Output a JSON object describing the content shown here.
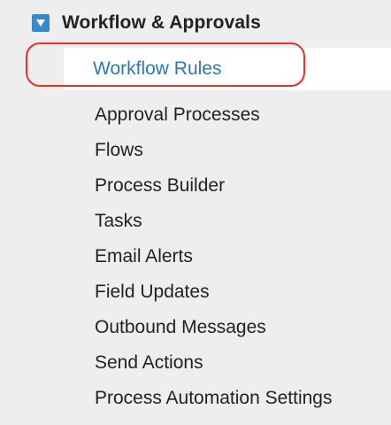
{
  "section": {
    "title": "Workflow & Approvals",
    "toggle_icon": "collapse-triangle-icon",
    "active_item": "Workflow Rules",
    "items": [
      "Approval Processes",
      "Flows",
      "Process Builder",
      "Tasks",
      "Email Alerts",
      "Field Updates",
      "Outbound Messages",
      "Send Actions",
      "Process Automation Settings"
    ]
  },
  "colors": {
    "toggle_icon_bg": "#3a88c6",
    "active_link": "#2a78b4",
    "highlight_ring": "#e3322b",
    "panel_bg": "#eeeeee"
  }
}
